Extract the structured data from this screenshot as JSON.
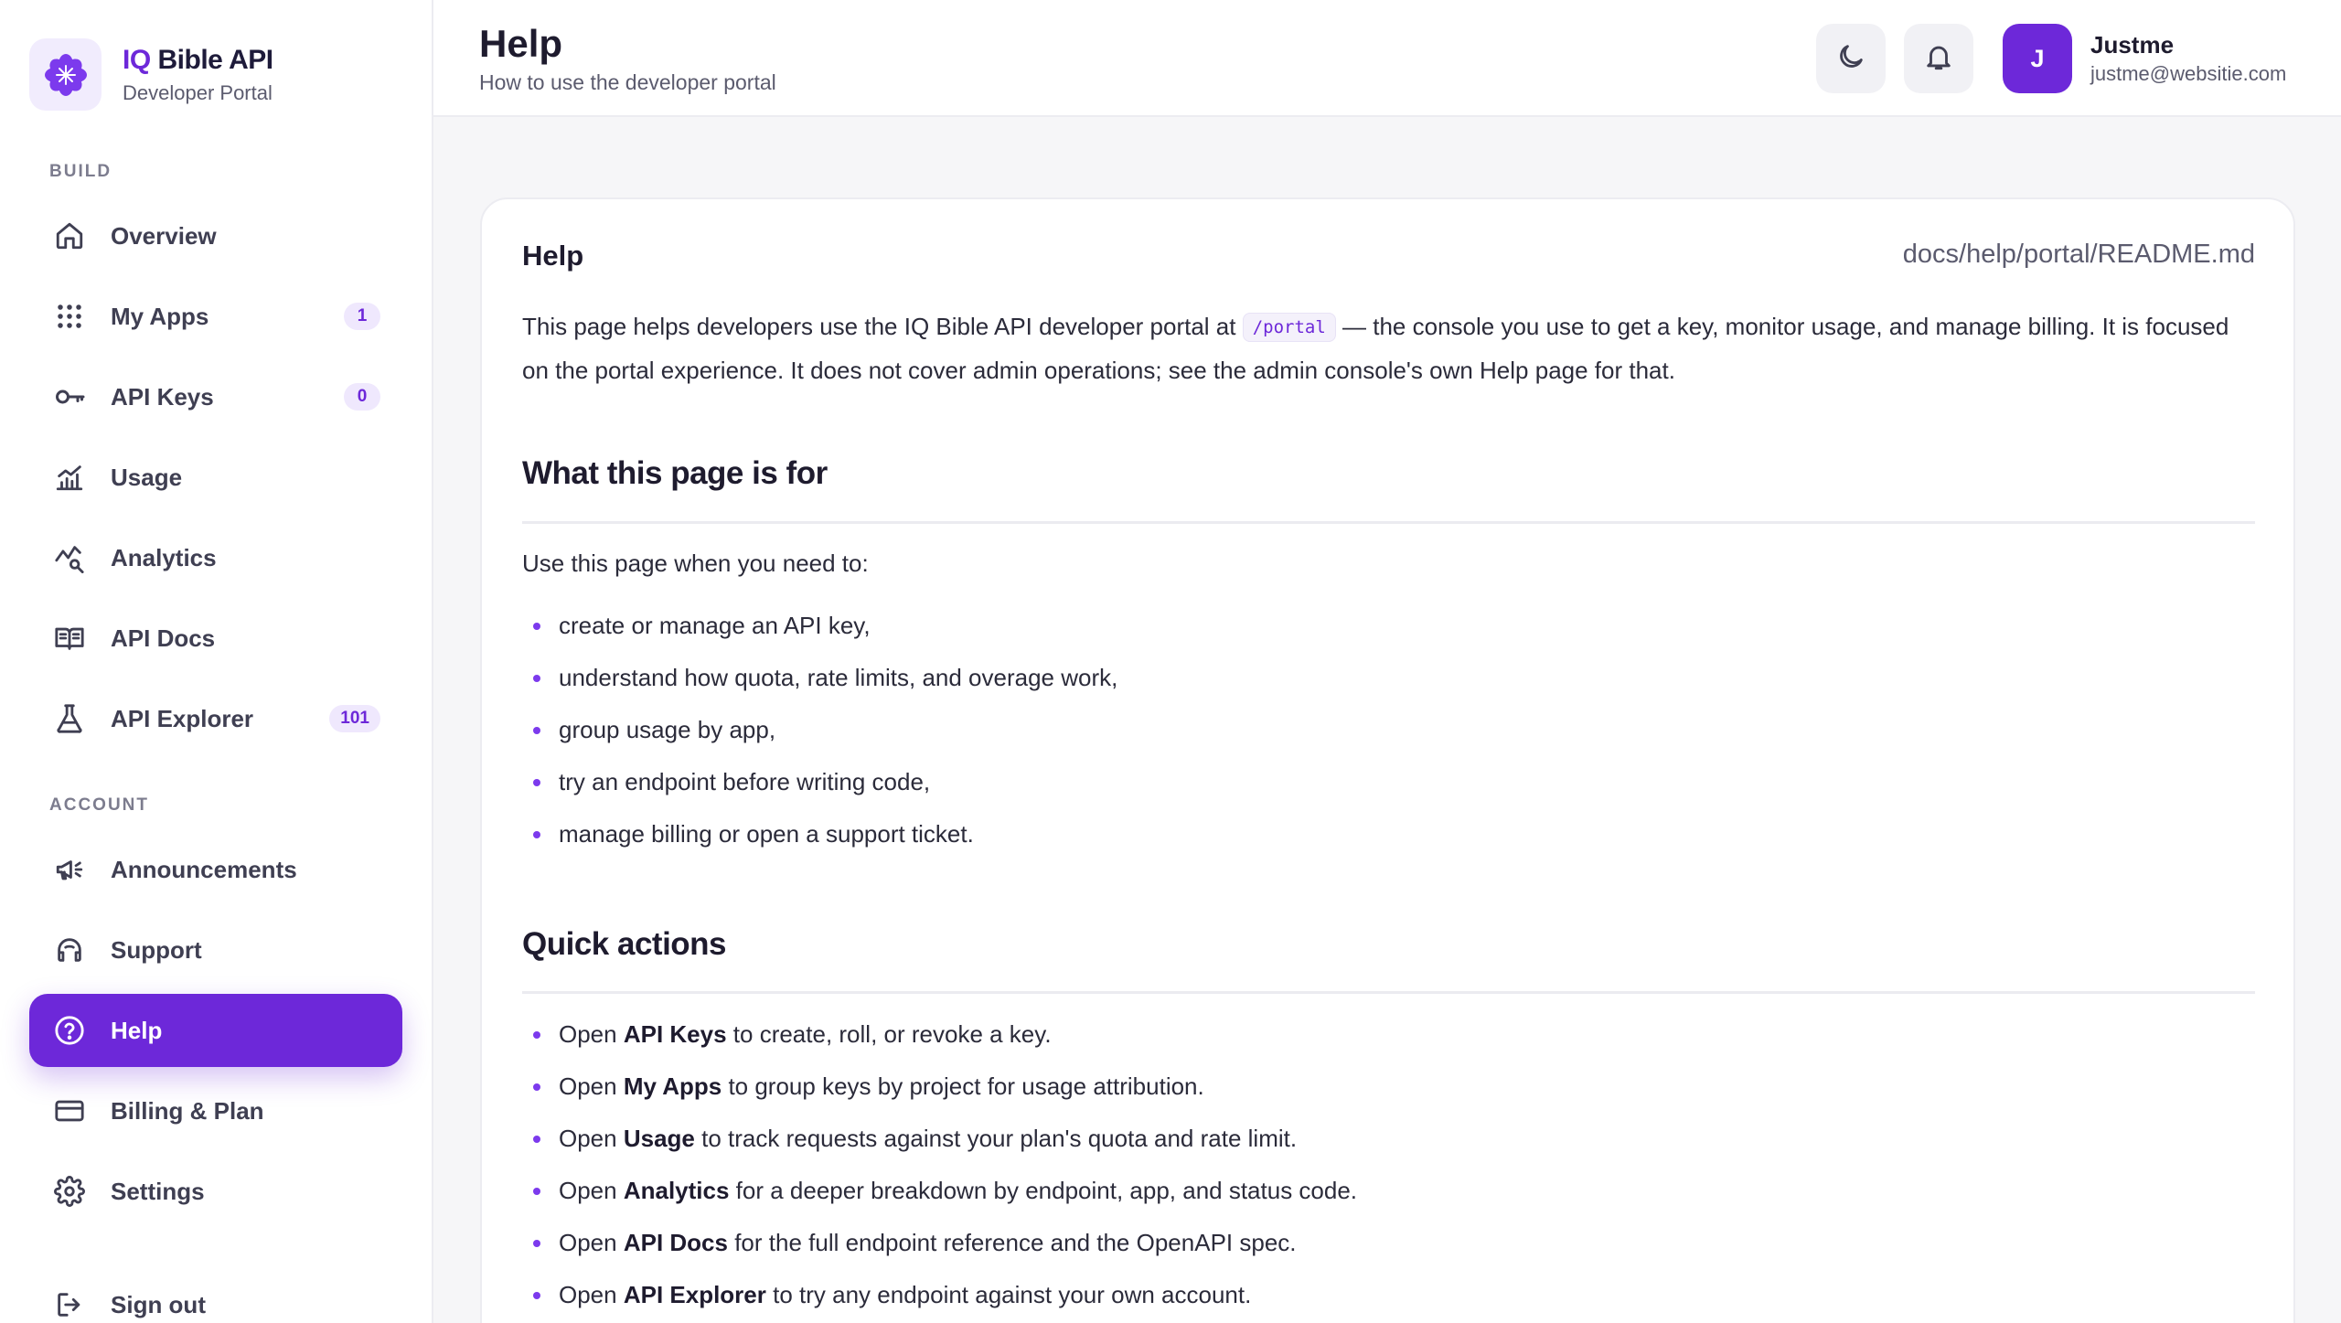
{
  "brand": {
    "title_prefix": "IQ",
    "title_rest": " Bible API",
    "subtitle": "Developer Portal"
  },
  "sidebar": {
    "build_label": "BUILD",
    "account_label": "ACCOUNT",
    "build_items": [
      {
        "label": "Overview",
        "icon": "home-icon",
        "badge": null
      },
      {
        "label": "My Apps",
        "icon": "grid-icon",
        "badge": "1"
      },
      {
        "label": "API Keys",
        "icon": "key-icon",
        "badge": "0"
      },
      {
        "label": "Usage",
        "icon": "bar-chart-icon",
        "badge": null
      },
      {
        "label": "Analytics",
        "icon": "analytics-icon",
        "badge": null
      },
      {
        "label": "API Docs",
        "icon": "book-icon",
        "badge": null
      },
      {
        "label": "API Explorer",
        "icon": "flask-icon",
        "badge": "101"
      }
    ],
    "account_items": [
      {
        "label": "Announcements",
        "icon": "megaphone-icon"
      },
      {
        "label": "Support",
        "icon": "headset-icon"
      },
      {
        "label": "Help",
        "icon": "help-circle-icon",
        "active": true
      },
      {
        "label": "Billing & Plan",
        "icon": "credit-card-icon"
      },
      {
        "label": "Settings",
        "icon": "gear-icon"
      }
    ],
    "sign_out": "Sign out"
  },
  "header": {
    "title": "Help",
    "subtitle": "How to use the developer portal",
    "user": {
      "initial": "J",
      "name": "Justme",
      "email": "justme@websitie.com"
    }
  },
  "doc": {
    "title": "Help",
    "path": "docs/help/portal/README.md",
    "intro_before": "This page helps developers use the IQ Bible API developer portal at ",
    "intro_code": "/portal",
    "intro_after": " — the console you use to get a key, monitor usage, and manage billing. It is focused on the portal experience. It does not cover admin operations; see the admin console's own Help page for that.",
    "section1_heading": "What this page is for",
    "section1_para": "Use this page when you need to:",
    "section1_items": [
      "create or manage an API key,",
      "understand how quota, rate limits, and overage work,",
      "group usage by app,",
      "try an endpoint before writing code,",
      "manage billing or open a support ticket."
    ],
    "section2_heading": "Quick actions",
    "section2_items": [
      {
        "pre": "Open ",
        "bold": "API Keys",
        "post": " to create, roll, or revoke a key."
      },
      {
        "pre": "Open ",
        "bold": "My Apps",
        "post": " to group keys by project for usage attribution."
      },
      {
        "pre": "Open ",
        "bold": "Usage",
        "post": " to track requests against your plan's quota and rate limit."
      },
      {
        "pre": "Open ",
        "bold": "Analytics",
        "post": " for a deeper breakdown by endpoint, app, and status code."
      },
      {
        "pre": "Open ",
        "bold": "API Docs",
        "post": " for the full endpoint reference and the OpenAPI spec."
      },
      {
        "pre": "Open ",
        "bold": "API Explorer",
        "post": " to try any endpoint against your own account."
      }
    ]
  },
  "colors": {
    "accent": "#6d28d9",
    "accent_soft": "#efe8fd",
    "background": "#f6f6f8"
  }
}
